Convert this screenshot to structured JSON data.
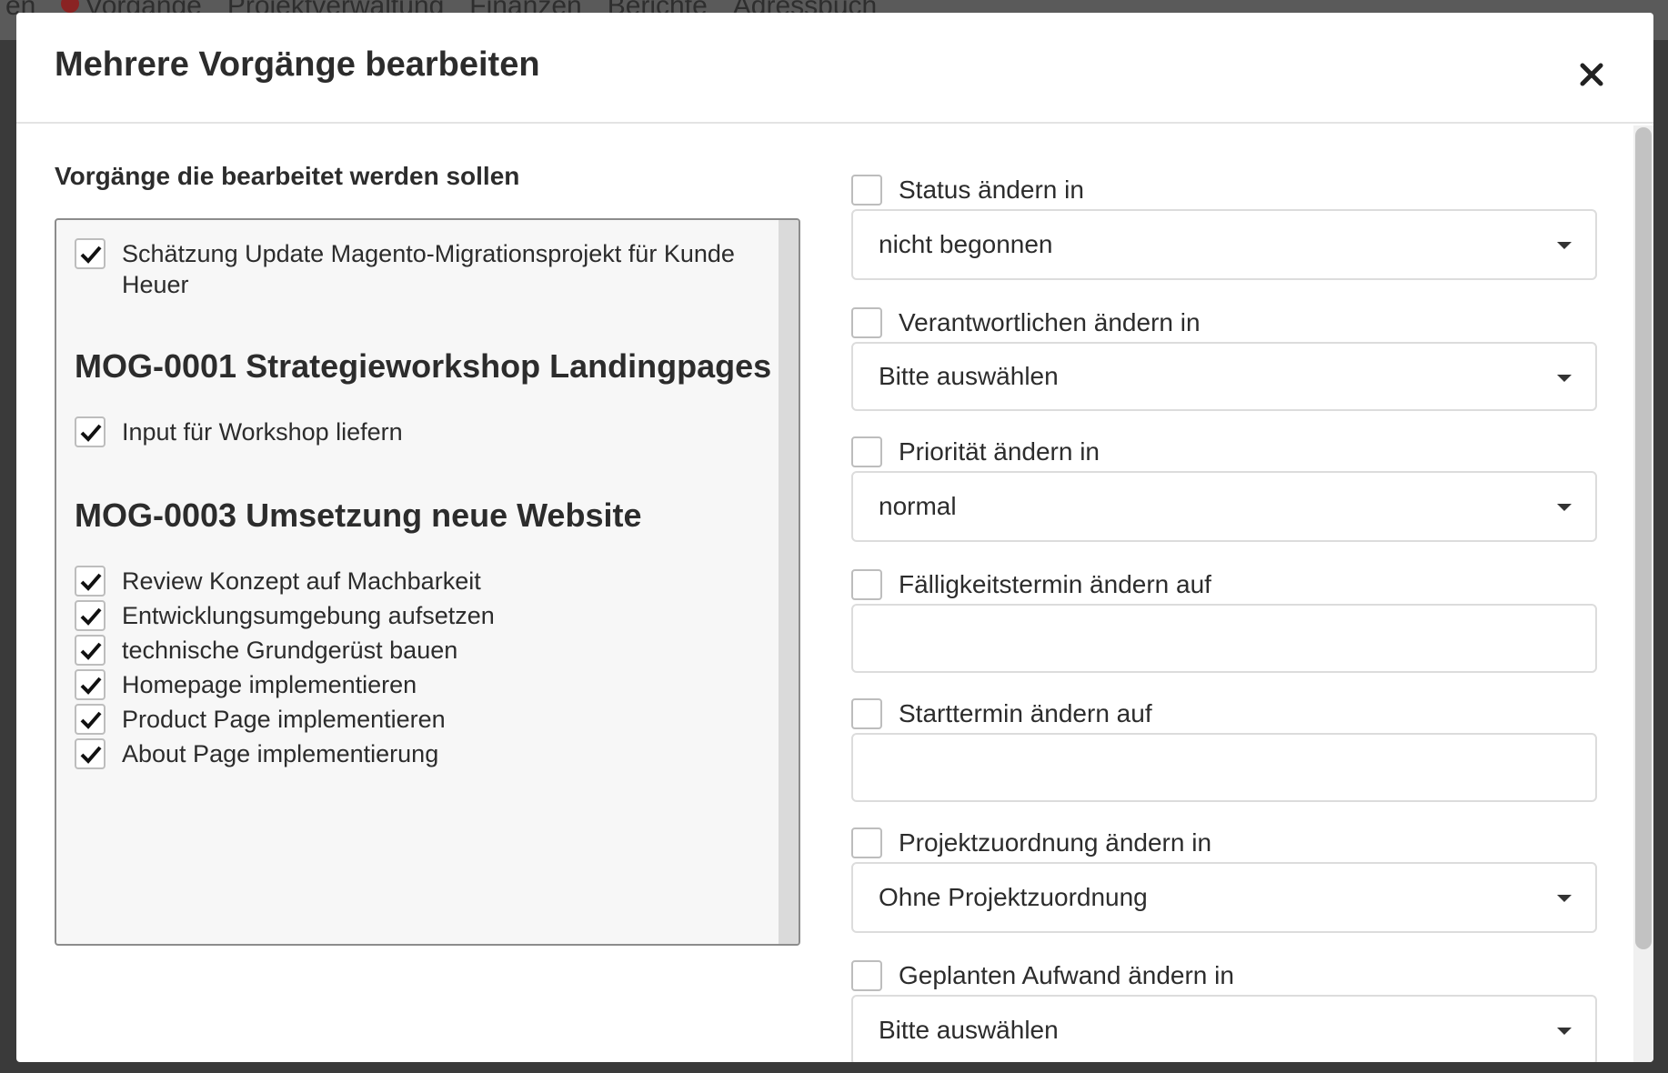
{
  "background": {
    "nav_items": [
      "en",
      "Vorgänge",
      "Projektverwaltung",
      "Finanzen",
      "Berichte",
      "Adressbuch"
    ]
  },
  "modal": {
    "title": "Mehrere Vorgänge bearbeiten",
    "close_icon": "close-icon"
  },
  "left": {
    "section_title": "Vorgänge die bearbeitet werden sollen",
    "ungrouped_tasks": [
      {
        "label": "Schätzung Update Magento-Migrationsprojekt für Kunde Heuer",
        "checked": true
      }
    ],
    "groups": [
      {
        "title": "MOG-0001 Strategieworkshop Landingpages",
        "tasks": [
          {
            "label": "Input für Workshop liefern",
            "checked": true
          }
        ]
      },
      {
        "title": "MOG-0003 Umsetzung neue Website",
        "tasks": [
          {
            "label": "Review Konzept auf Machbarkeit",
            "checked": true
          },
          {
            "label": "Entwicklungsumgebung aufsetzen",
            "checked": true
          },
          {
            "label": "technische Grundgerüst bauen",
            "checked": true
          },
          {
            "label": "Homepage implementieren",
            "checked": true
          },
          {
            "label": "Product Page implementieren",
            "checked": true
          },
          {
            "label": "About Page implementierung",
            "checked": true
          }
        ]
      }
    ]
  },
  "right": {
    "fields": [
      {
        "label": "Status ändern in",
        "type": "select",
        "value": "nicht begonnen",
        "checked": false
      },
      {
        "label": "Verantwortlichen ändern in",
        "type": "select",
        "value": "Bitte auswählen",
        "checked": false
      },
      {
        "label": "Priorität ändern in",
        "type": "select",
        "value": "normal",
        "checked": false
      },
      {
        "label": "Fälligkeitstermin ändern auf",
        "type": "input",
        "value": "",
        "checked": false
      },
      {
        "label": "Starttermin ändern auf",
        "type": "input",
        "value": "",
        "checked": false
      },
      {
        "label": "Projektzuordnung ändern in",
        "type": "select",
        "value": "Ohne Projektzuordnung",
        "checked": false
      },
      {
        "label": "Geplanten Aufwand ändern in",
        "type": "select",
        "value": "Bitte auswählen",
        "checked": false
      }
    ]
  }
}
